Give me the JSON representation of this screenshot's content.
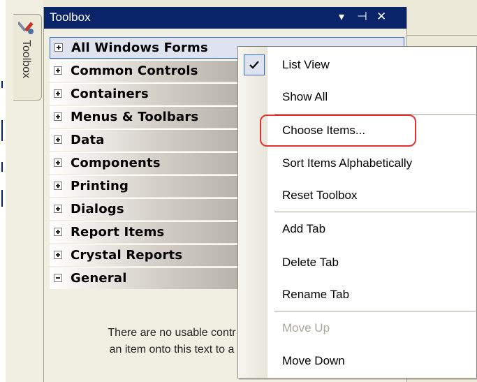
{
  "sidebar_tab": {
    "label": "Toolbox",
    "icon": "toolbox-tools-icon"
  },
  "panel": {
    "title": "Toolbox",
    "controls": [
      {
        "name": "dropdown-arrow-icon",
        "glyph": "▾"
      },
      {
        "name": "pin-icon",
        "glyph": "⊣"
      },
      {
        "name": "close-icon",
        "glyph": "✕"
      }
    ],
    "sections": [
      {
        "label": "All Windows Forms",
        "expanded": false
      },
      {
        "label": "Common Controls",
        "expanded": false
      },
      {
        "label": "Containers",
        "expanded": false
      },
      {
        "label": "Menus & Toolbars",
        "expanded": false
      },
      {
        "label": "Data",
        "expanded": false
      },
      {
        "label": "Components",
        "expanded": false
      },
      {
        "label": "Printing",
        "expanded": false
      },
      {
        "label": "Dialogs",
        "expanded": false
      },
      {
        "label": "Report Items",
        "expanded": false
      },
      {
        "label": "Crystal Reports",
        "expanded": false
      },
      {
        "label": "General",
        "expanded": true
      }
    ],
    "empty_message_line1": "There are no usable contr",
    "empty_message_line2": "an item onto this text to a"
  },
  "context_menu": {
    "items": [
      {
        "label": "List View",
        "checked": true,
        "disabled": false
      },
      {
        "label": "Show All",
        "checked": false,
        "disabled": false
      },
      {
        "label": "Choose Items...",
        "checked": false,
        "disabled": false,
        "highlighted": true
      },
      {
        "label": "Sort Items Alphabetically",
        "checked": false,
        "disabled": false
      },
      {
        "label": "Reset Toolbox",
        "checked": false,
        "disabled": false
      },
      {
        "label": "Add Tab",
        "checked": false,
        "disabled": false
      },
      {
        "label": "Delete Tab",
        "checked": false,
        "disabled": false
      },
      {
        "label": "Rename Tab",
        "checked": false,
        "disabled": false
      },
      {
        "label": "Move Up",
        "checked": false,
        "disabled": true
      },
      {
        "label": "Move Down",
        "checked": false,
        "disabled": false
      }
    ],
    "highlight_color": "#e03030"
  },
  "colors": {
    "titlebar": "#0a246a",
    "check_background": "#dfe2ef",
    "check_border": "#316ac5"
  }
}
